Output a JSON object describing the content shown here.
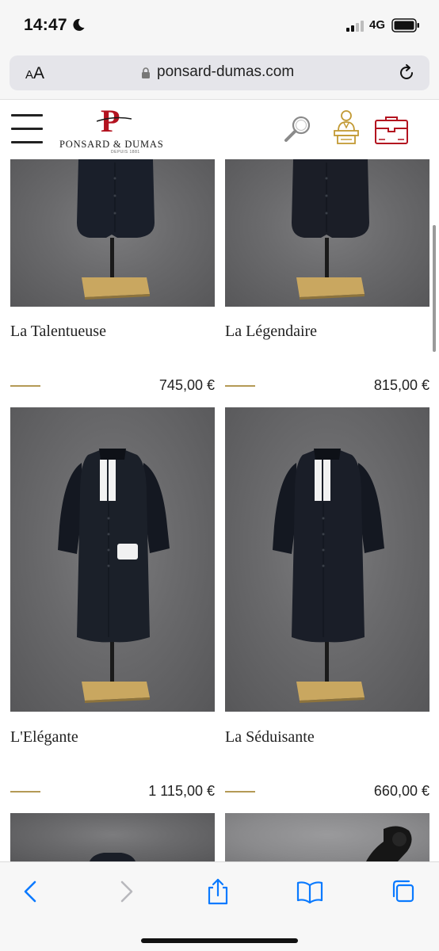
{
  "status_bar": {
    "time": "14:47",
    "network": "4G",
    "icons": [
      "moon-icon",
      "signal-icon",
      "battery-icon"
    ]
  },
  "browser": {
    "text_size_label_small": "A",
    "text_size_label_large": "A",
    "url": "ponsard-dumas.com",
    "icons": [
      "lock-icon",
      "reload-icon"
    ]
  },
  "site_header": {
    "logo_letter": "P",
    "logo_name": "PONSARD & DUMAS",
    "logo_tagline": "DEPUIS 1881",
    "icons": [
      "menu-icon",
      "search-icon",
      "lawyer-icon",
      "briefcase-icon"
    ]
  },
  "products": [
    {
      "name": "La Talentueuse",
      "price": "745,00 €"
    },
    {
      "name": "La Légendaire",
      "price": "815,00 €"
    },
    {
      "name": "L'Elégante",
      "price": "1 115,00 €"
    },
    {
      "name": "La Séduisante",
      "price": "660,00 €"
    }
  ],
  "toolbar": {
    "icons": [
      "back-icon",
      "forward-icon",
      "share-icon",
      "bookmarks-icon",
      "tabs-icon"
    ]
  },
  "colors": {
    "brand_red": "#b3121f",
    "gold_line": "#b49a55",
    "ios_blue": "#0a7aff"
  }
}
